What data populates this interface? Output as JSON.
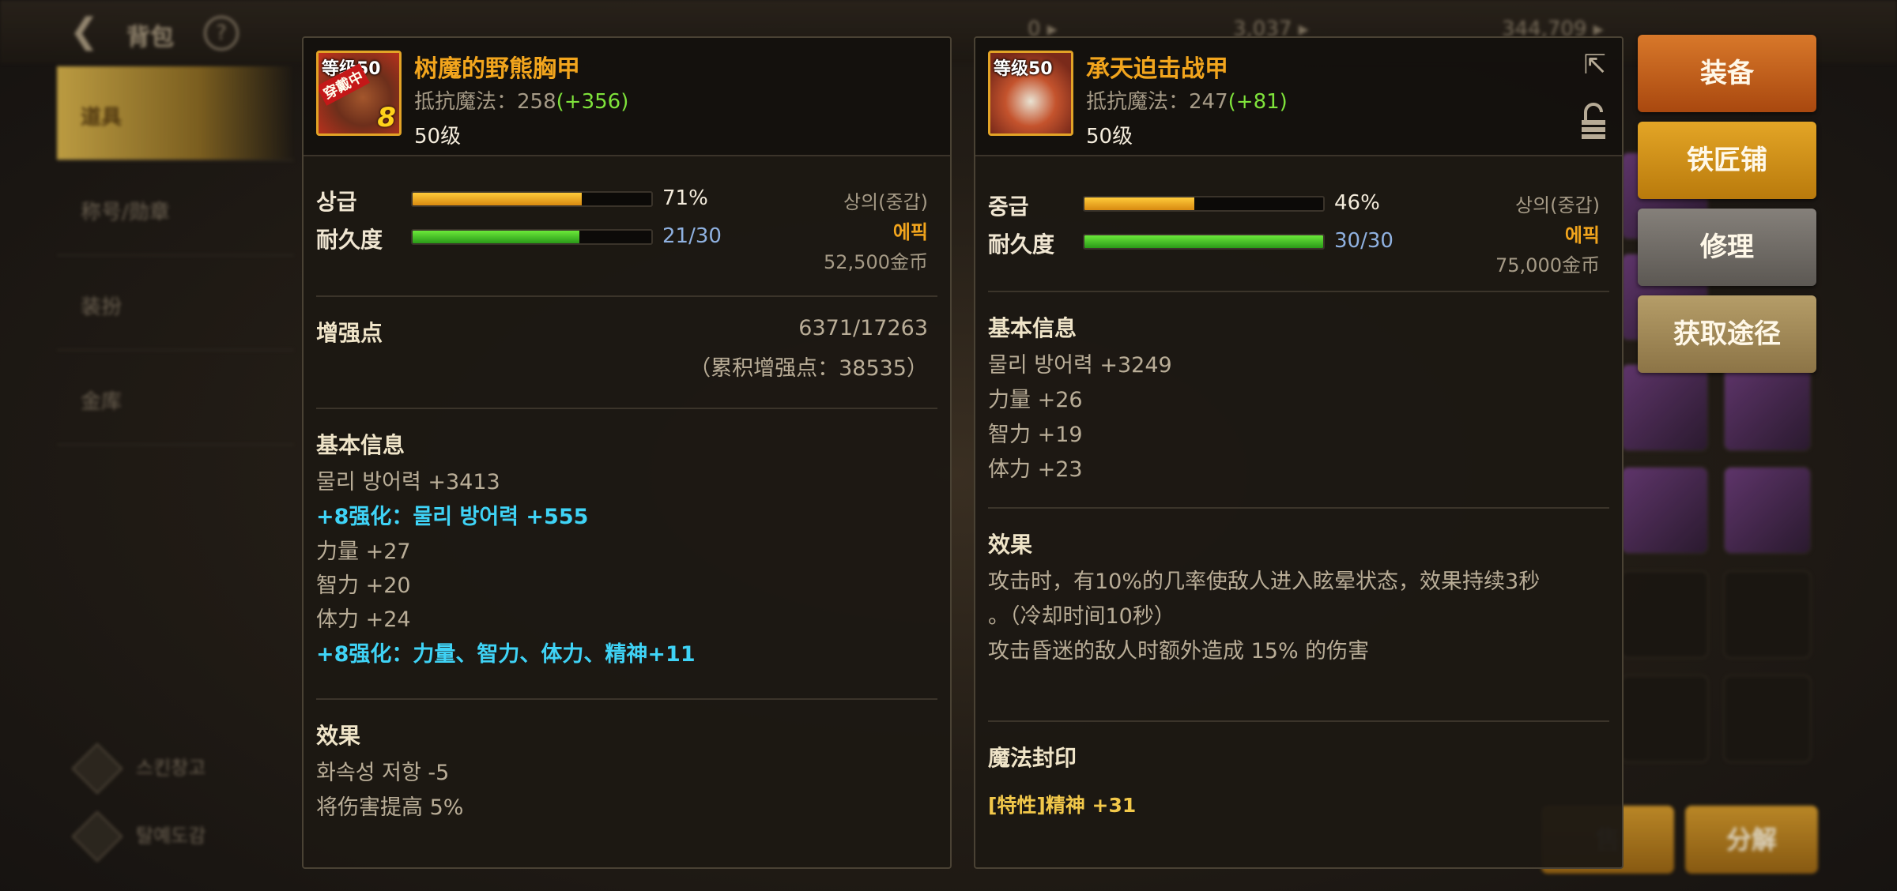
{
  "background": {
    "title": "背包",
    "back_icon": "back-arrow-icon",
    "stat_1": "0 ▸",
    "stat_2": "3,037 ▸",
    "stat_3": "344,709 ▸",
    "nav": [
      {
        "label": "道具",
        "active": true
      },
      {
        "label": "称号/勋章",
        "active": false
      },
      {
        "label": "装扮",
        "active": false
      },
      {
        "label": "金库",
        "active": false
      }
    ],
    "nav_footer": [
      "스킨창고",
      "탈예도감"
    ],
    "bottom_buttons": [
      "售",
      "分解"
    ]
  },
  "left_item": {
    "icon_level": "等级50",
    "icon_badge": "穿戴中",
    "icon_plus": "8",
    "name": "树魔的野熊胸甲",
    "resist_label": "抵抗魔法：",
    "resist_value": "258",
    "resist_bonus": "(+356)",
    "req_level": "50级",
    "grade_label": "상급",
    "grade_percent": 71,
    "grade_text": "71%",
    "durability_label": "耐久度",
    "durability_current": 21,
    "durability_max": 30,
    "durability_text": "21/30",
    "slot_type": "상의(중갑)",
    "rarity": "에픽",
    "price": "52,500金币",
    "enhance_title": "增强点",
    "enhance_value": "6371/17263",
    "enhance_total": "（累积增强点：38535）",
    "basic_title": "基本信息",
    "basic_lines": [
      {
        "text": "물리 방어력 +3413",
        "style": "normal"
      },
      {
        "text": "+8强化：물리 방어력 +555",
        "style": "cyan"
      },
      {
        "text": "力量 +27",
        "style": "normal"
      },
      {
        "text": "智力 +20",
        "style": "normal"
      },
      {
        "text": "体力 +24",
        "style": "normal"
      },
      {
        "text": "+8强化：力量、智力、体力、精神+11",
        "style": "cyan"
      }
    ],
    "effect_title": "效果",
    "effect_lines": [
      "화속성 저항 -5",
      "将伤害提高 5%"
    ]
  },
  "right_item": {
    "icon_level": "等级50",
    "name": "承天迫击战甲",
    "resist_label": "抵抗魔法：",
    "resist_value": "247",
    "resist_bonus": "(+81)",
    "req_level": "50级",
    "share_icon": "share-icon",
    "lock_icon": "lock-icon",
    "grade_label": "중급",
    "grade_percent": 46,
    "grade_text": "46%",
    "durability_label": "耐久度",
    "durability_current": 30,
    "durability_max": 30,
    "durability_text": "30/30",
    "slot_type": "상의(중갑)",
    "rarity": "에픽",
    "price": "75,000金币",
    "basic_title": "基本信息",
    "basic_lines": [
      "물리 방어력 +3249",
      "力量 +26",
      "智力 +19",
      "体力 +23"
    ],
    "effect_title": "效果",
    "effect_lines": [
      "攻击时，有10%的几率使敌人进入眩晕状态，效果持续3秒",
      "。（冷却时间10秒）",
      "攻击昏迷的敌人时额外造成 15% 的伤害"
    ],
    "seal_title": "魔法封印",
    "seal_line": "[特性]精神 +31"
  },
  "actions": {
    "equip": "装备",
    "blacksmith": "铁匠铺",
    "repair": "修理",
    "obtain": "获取途径"
  },
  "colors": {
    "name": "#f2a51d",
    "bonus_green": "#7fe33b",
    "cyan": "#3fd3f6",
    "rarity": "#f2a51d",
    "equip_btn": "#c8661b",
    "blacksmith_btn": "#d19318",
    "repair_btn": "#6f6a63",
    "obtain_btn": "#a58c5a"
  }
}
